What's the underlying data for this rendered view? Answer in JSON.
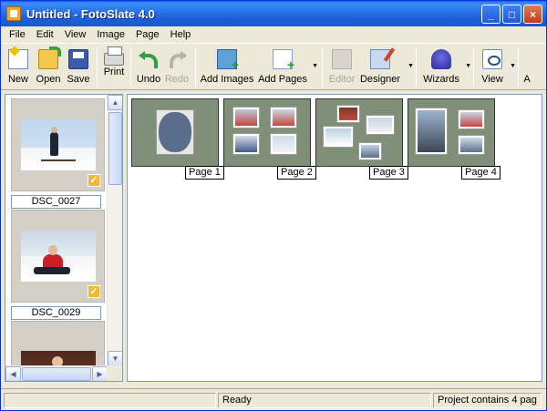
{
  "window": {
    "title": "Untitled - FotoSlate 4.0",
    "controls": {
      "minimize": "_",
      "maximize": "□",
      "close": "×"
    }
  },
  "menu": [
    "File",
    "Edit",
    "View",
    "Image",
    "Page",
    "Help"
  ],
  "toolbar": {
    "new": "New",
    "open": "Open",
    "save": "Save",
    "print": "Print",
    "undo": "Undo",
    "redo": "Redo",
    "add_images": "Add Images",
    "add_pages": "Add Pages",
    "editor": "Editor",
    "designer": "Designer",
    "wizards": "Wizards",
    "view": "View",
    "overflow": "A"
  },
  "thumbnails": [
    {
      "caption": "DSC_0027",
      "checked": "✓"
    },
    {
      "caption": "DSC_0029",
      "checked": "✓"
    },
    {
      "caption": "",
      "checked": ""
    }
  ],
  "pages": [
    {
      "label": "Page 1"
    },
    {
      "label": "Page 2"
    },
    {
      "label": "Page 3"
    },
    {
      "label": "Page 4"
    }
  ],
  "status": {
    "left": "",
    "center": "Ready",
    "right": "Project contains 4 pag"
  },
  "colors": {
    "title_bar": "#1C5FD8",
    "page_background": "#7F8F78",
    "close_button": "#C6391A"
  },
  "icons": [
    "new-icon",
    "open-icon",
    "save-icon",
    "print-icon",
    "undo-icon",
    "redo-icon",
    "add-images-icon",
    "add-pages-icon",
    "editor-icon",
    "designer-icon",
    "wizards-icon",
    "view-icon"
  ]
}
